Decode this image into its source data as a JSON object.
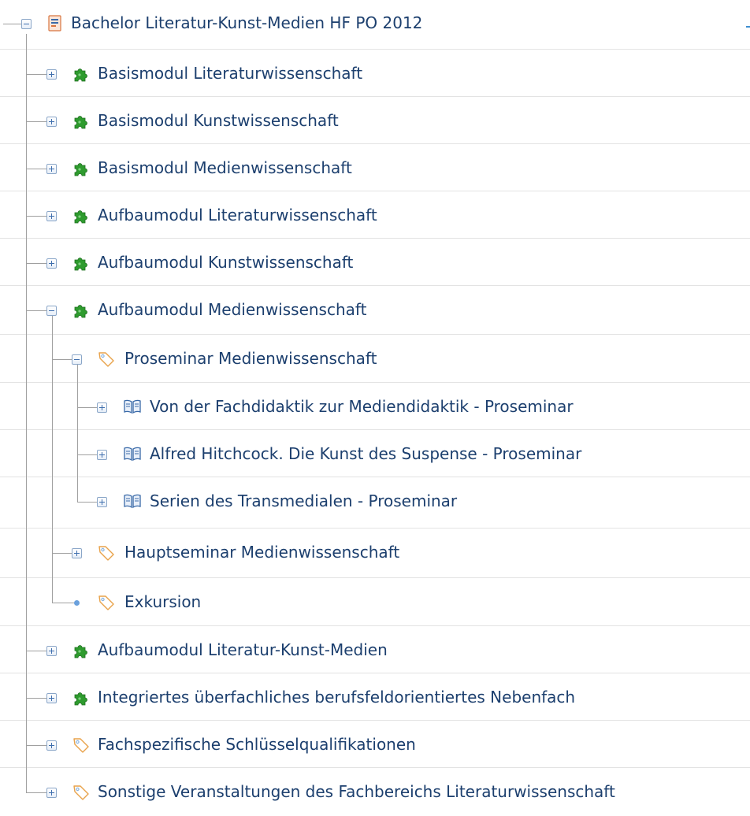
{
  "tree": {
    "nodes": [
      {
        "label": "Bachelor Literatur-Kunst-Medien HF PO 2012",
        "icon": "document-icon",
        "toggle": "collapse",
        "level": 0
      },
      {
        "label": "Basismodul Literaturwissenschaft",
        "icon": "puzzle-icon",
        "toggle": "expand",
        "level": 1
      },
      {
        "label": "Basismodul Kunstwissenschaft",
        "icon": "puzzle-icon",
        "toggle": "expand",
        "level": 1
      },
      {
        "label": "Basismodul Medienwissenschaft",
        "icon": "puzzle-icon",
        "toggle": "expand",
        "level": 1
      },
      {
        "label": "Aufbaumodul Literaturwissenschaft",
        "icon": "puzzle-icon",
        "toggle": "expand",
        "level": 1
      },
      {
        "label": "Aufbaumodul Kunstwissenschaft",
        "icon": "puzzle-icon",
        "toggle": "expand",
        "level": 1
      },
      {
        "label": "Aufbaumodul Medienwissenschaft",
        "icon": "puzzle-icon",
        "toggle": "collapse",
        "level": 1
      },
      {
        "label": "Proseminar Medienwissenschaft",
        "icon": "tag-icon",
        "toggle": "collapse",
        "level": 2
      },
      {
        "label": "Von der Fachdidaktik zur Mediendidaktik - Proseminar",
        "icon": "book-icon",
        "toggle": "expand",
        "level": 3
      },
      {
        "label": "Alfred Hitchcock. Die Kunst des Suspense - Proseminar",
        "icon": "book-icon",
        "toggle": "expand",
        "level": 3
      },
      {
        "label": "Serien des Transmedialen - Proseminar",
        "icon": "book-icon",
        "toggle": "expand",
        "level": 3
      },
      {
        "label": "Hauptseminar Medienwissenschaft",
        "icon": "tag-icon",
        "toggle": "expand",
        "level": 2
      },
      {
        "label": "Exkursion",
        "icon": "tag-icon",
        "toggle": "leaf",
        "level": 2
      },
      {
        "label": "Aufbaumodul Literatur-Kunst-Medien",
        "icon": "puzzle-icon",
        "toggle": "expand",
        "level": 1
      },
      {
        "label": "Integriertes überfachliches berufsfeldorientiertes Nebenfach",
        "icon": "puzzle-icon",
        "toggle": "expand",
        "level": 1
      },
      {
        "label": "Fachspezifische Schlüsselqualifikationen",
        "icon": "tag-icon",
        "toggle": "expand",
        "level": 1
      },
      {
        "label": "Sonstige Veranstaltungen des Fachbereichs Literaturwissenschaft",
        "icon": "tag-icon",
        "toggle": "expand",
        "level": 1
      }
    ]
  },
  "colors": {
    "label_text": "#1c3f6e",
    "connector_lines": "#a0a0a0",
    "separator": "#e3e3e3",
    "toggle_border": "#8aa6c8",
    "puzzle_green": "#2e9b2e",
    "tag_orange": "#e8a24a",
    "tag_blue": "#8ab4e0",
    "book_blue": "#3a6aa8",
    "leaf_dot": "#6aa0dc"
  }
}
